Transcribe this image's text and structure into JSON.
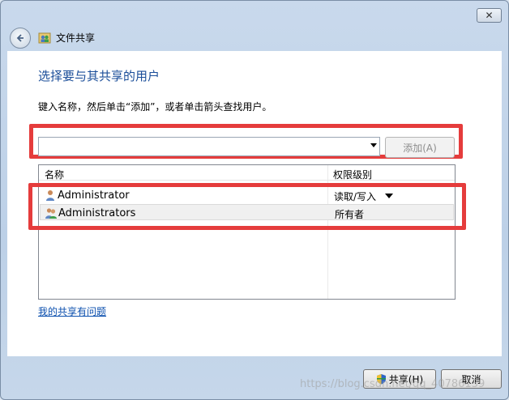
{
  "window": {
    "title": "文件共享",
    "close_glyph": "✕"
  },
  "main": {
    "heading": "选择要与其共享的用户",
    "instruction": "键入名称，然后单击“添加”，或者单击箭头查找用户。",
    "name_input_value": "",
    "add_button_label": "添加(A)"
  },
  "list": {
    "headers": {
      "name": "名称",
      "permission": "权限级别"
    },
    "rows": [
      {
        "name": "Administrator",
        "permission": "读取/写入"
      },
      {
        "name": "Administrators",
        "permission": "所有者"
      }
    ]
  },
  "help_link": "我的共享有问题",
  "footer": {
    "share_button_label": "共享(H)",
    "cancel_button_label": "取消"
  },
  "watermark": "https://blog.csdn.net/qq_40786139",
  "colors": {
    "heading": "#1a4d99",
    "link": "#0b4fae",
    "highlight_box": "#e53c3c"
  }
}
